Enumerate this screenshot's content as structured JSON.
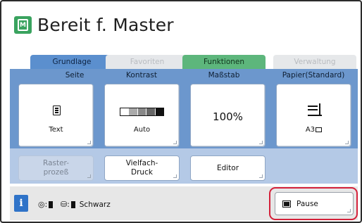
{
  "title": "Bereit f. Master",
  "title_icon_glyph": "M",
  "tabs": [
    {
      "label": "Grundlage",
      "state": "active"
    },
    {
      "label": "Favoriten",
      "state": "disabled"
    },
    {
      "label": "Funktionen",
      "state": "enabled"
    },
    {
      "label": "Verwaltung",
      "state": "disabled"
    }
  ],
  "columns": [
    "Seite",
    "Kontrast",
    "Maßstab",
    "Papier(Standard)"
  ],
  "main_buttons": {
    "seite": {
      "caption": "Text",
      "icon": "text-document-icon"
    },
    "kontrast": {
      "caption": "Auto",
      "icon": "contrast-scale-icon"
    },
    "massstab": {
      "value": "100%"
    },
    "papier": {
      "caption": "A3",
      "icon": "paper-stack-icon"
    }
  },
  "secondary_buttons": [
    {
      "label": "Raster-\nprozeß",
      "enabled": false
    },
    {
      "label": "Vielfach-\nDruck",
      "enabled": true
    },
    {
      "label": "Editor",
      "enabled": true
    }
  ],
  "status": {
    "info_label": "i",
    "drum_separator": ":",
    "ink_separator": ":",
    "ink_color": "Schwarz"
  },
  "pause": {
    "label": "Pause"
  },
  "colors": {
    "title_icon": "#3aa35f",
    "tab_active": "#5b8fce",
    "tab_functions": "#5db67c",
    "panel": "#6c97cd",
    "info_button": "#2f73c8",
    "highlight": "#d4213a"
  }
}
